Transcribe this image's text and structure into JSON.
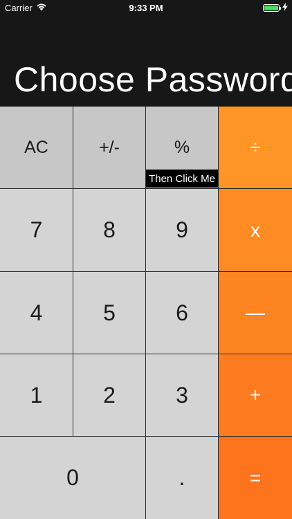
{
  "status_bar": {
    "carrier": "Carrier",
    "time": "9:33 PM",
    "icons": [
      "wifi-icon",
      "battery-icon",
      "charging-bolt-icon"
    ]
  },
  "display": {
    "title": "Choose Password"
  },
  "keys": {
    "ac": "AC",
    "plus_minus": "+/-",
    "percent": "%",
    "divide": "÷",
    "seven": "7",
    "eight": "8",
    "nine": "9",
    "multiply": "x",
    "four": "4",
    "five": "5",
    "six": "6",
    "minus": "—",
    "one": "1",
    "two": "2",
    "three": "3",
    "plus": "+",
    "zero": "0",
    "decimal": ".",
    "equals": "="
  },
  "hint": {
    "text": "Then Click Me"
  },
  "colors": {
    "operator": "#fe8c23",
    "function_key": "#c7c7c7",
    "number_key": "#d4d4d4",
    "background": "#171717"
  }
}
